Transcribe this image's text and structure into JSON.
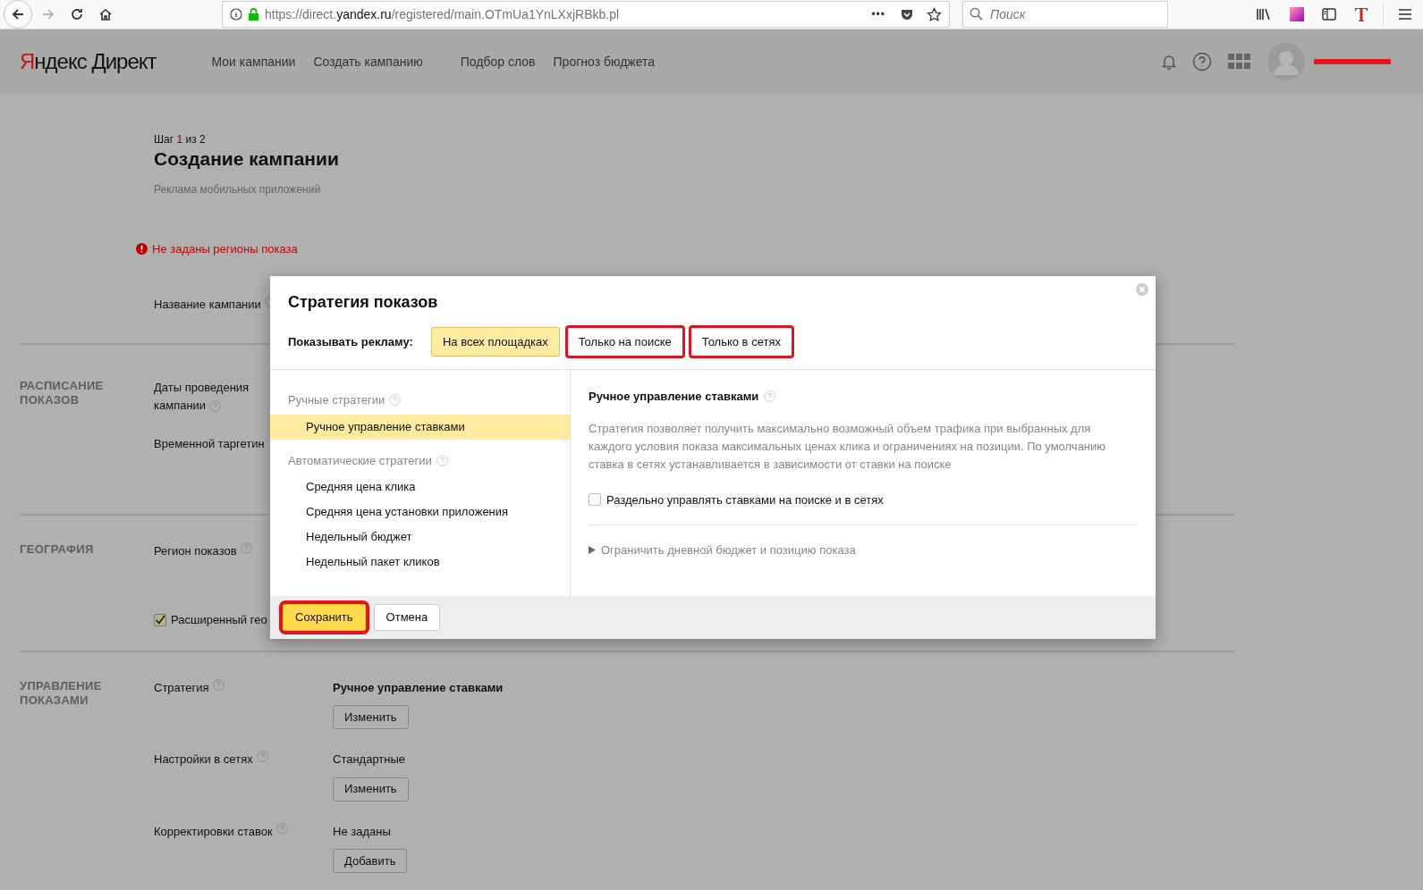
{
  "browser": {
    "url_prefix": "https://direct.",
    "url_domain": "yandex.ru",
    "url_path": "/registered/main.OTmUa1YnLXxjRBkb.pl",
    "more": "•••",
    "search_placeholder": "Поиск"
  },
  "header": {
    "brand_initial": "Я",
    "brand_rest": "ндекс",
    "product": "Директ",
    "nav": [
      {
        "label": "Мои кампании"
      },
      {
        "label": "Создать кампанию"
      },
      {
        "label": "Подбор слов"
      },
      {
        "label": "Прогноз бюджета"
      }
    ]
  },
  "page": {
    "step_prefix": "Шаг",
    "step_current": "1",
    "step_suffix": "из 2",
    "title": "Создание кампании",
    "subtitle": "Реклама мобильных приложений",
    "error": "Не заданы регионы показа",
    "sections": [
      {
        "rows": [
          {
            "kind": "text",
            "label": "Название кампании",
            "help": true
          }
        ]
      },
      {
        "heading": "РАСПИСАНИЕ ПОКАЗОВ",
        "rows": [
          {
            "kind": "text",
            "label": "Даты проведения кампании",
            "help": true
          },
          {
            "kind": "text",
            "label": "Временной таргетин",
            "help": false
          }
        ]
      },
      {
        "heading": "ГЕОГРАФИЯ",
        "rows": [
          {
            "kind": "text",
            "label": "Регион показов",
            "help": true
          },
          {
            "kind": "checkbox",
            "label": "Расширенный гео",
            "checked": true
          }
        ]
      },
      {
        "heading": "УПРАВЛЕНИЕ ПОКАЗАМИ",
        "rows": [
          {
            "kind": "setting",
            "label": "Стратегия",
            "help": true,
            "value": "Ручное управление ставками",
            "value_bold": true,
            "button": "Изменить"
          },
          {
            "kind": "setting",
            "label": "Настройки в сетях",
            "help": true,
            "value": "Стандартные",
            "value_bold": false,
            "button": "Изменить"
          },
          {
            "kind": "setting",
            "label": "Корректировки ставок",
            "help": true,
            "value": "Не заданы",
            "value_bold": false,
            "button": "Добавить"
          }
        ]
      }
    ]
  },
  "modal": {
    "title": "Стратегия показов",
    "show_label": "Показывать рекламу:",
    "tabs": [
      {
        "label": "На всех площадках",
        "selected": true,
        "highlighted": false
      },
      {
        "label": "Только на поиске",
        "selected": false,
        "highlighted": true
      },
      {
        "label": "Только в сетях",
        "selected": false,
        "highlighted": true
      }
    ],
    "groups": [
      {
        "title": "Ручные стратегии",
        "items": [
          {
            "label": "Ручное управление ставками",
            "selected": true
          }
        ]
      },
      {
        "title": "Автоматические стратегии",
        "items": [
          {
            "label": "Средняя цена клика",
            "selected": false
          },
          {
            "label": "Средняя цена установки приложения",
            "selected": false
          },
          {
            "label": "Недельный бюджет",
            "selected": false
          },
          {
            "label": "Недельный пакет кликов",
            "selected": false
          }
        ]
      }
    ],
    "detail_title": "Ручное управление ставками",
    "description": "Стратегия позволяет получить максимально возможный объем трафика при выбранных для каждого условия показа максимальных ценах клика и ограничениях на позиции. По умолчанию ставка в сетях устанавливается в зависимости от ставки на поиске",
    "checkbox": {
      "label": "Раздельно управлять ставками на поиске и в сетях",
      "checked": false
    },
    "expander": {
      "label": "Ограничить дневной бюджет и позицию показа",
      "expanded": false
    },
    "buttons": [
      {
        "label": "Сохранить",
        "kind": "primary",
        "highlighted": true
      },
      {
        "label": "Отмена",
        "kind": "default",
        "highlighted": false
      }
    ]
  }
}
